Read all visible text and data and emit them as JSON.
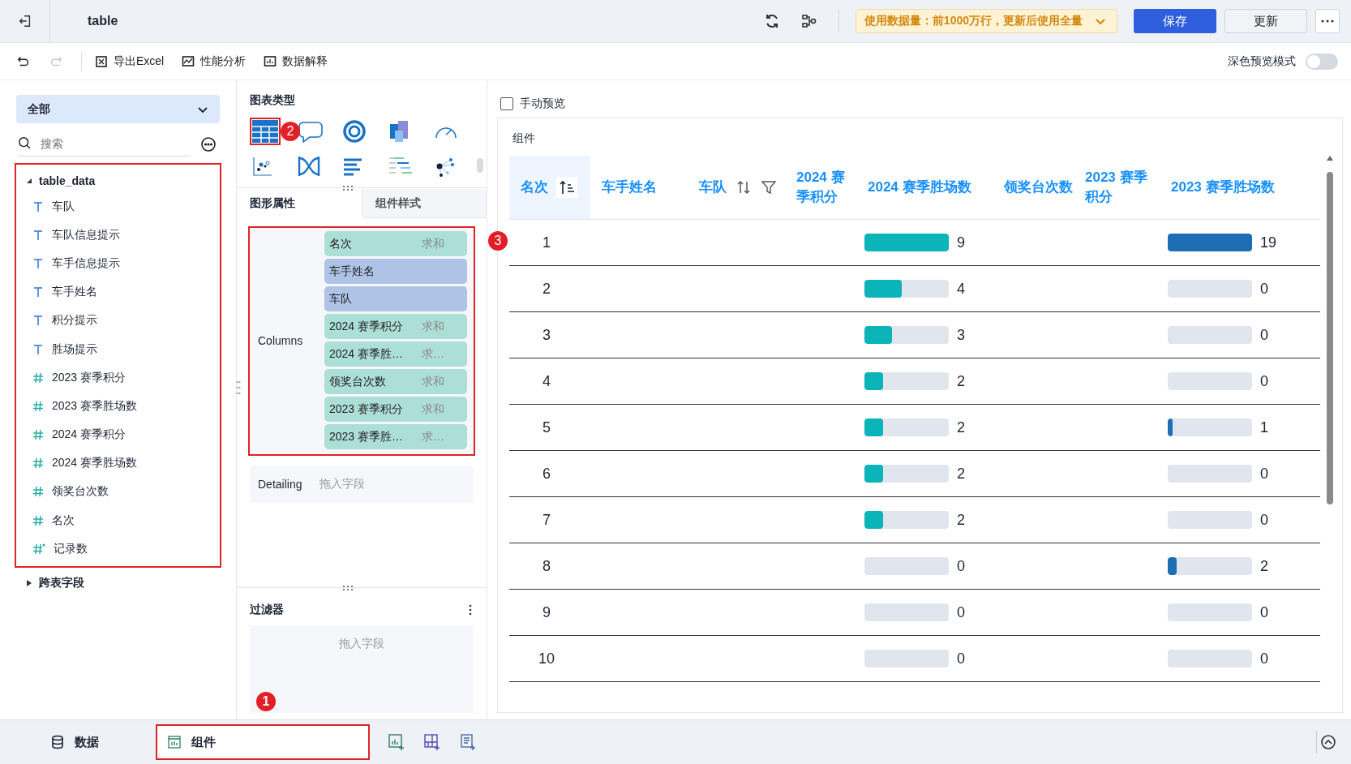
{
  "header": {
    "title": "table",
    "notice": "使用数据量：前1000万行，更新后使用全量",
    "save": "保存",
    "update": "更新"
  },
  "toolbar": {
    "items": [
      {
        "kind": "excel",
        "label": "导出Excel"
      },
      {
        "kind": "perf",
        "label": "性能分析"
      },
      {
        "kind": "explain",
        "label": "数据解释"
      }
    ],
    "dark_mode": {
      "label": "深色预览模式",
      "on": false
    }
  },
  "fields_panel": {
    "dropdown": "全部",
    "search_placeholder": "搜索",
    "highlighted": true,
    "tree": [
      {
        "label": "table_data",
        "expanded": true,
        "children": [
          {
            "label": "车队",
            "kind": "text"
          },
          {
            "label": "车队信息提示",
            "kind": "text"
          },
          {
            "label": "车手信息提示",
            "kind": "text"
          },
          {
            "label": "车手姓名",
            "kind": "text"
          },
          {
            "label": "积分提示",
            "kind": "text"
          },
          {
            "label": "胜场提示",
            "kind": "text"
          },
          {
            "label": "2023 赛季积分",
            "kind": "number"
          },
          {
            "label": "2023 赛季胜场数",
            "kind": "number"
          },
          {
            "label": "2024 赛季积分",
            "kind": "number"
          },
          {
            "label": "2024 赛季胜场数",
            "kind": "number"
          },
          {
            "label": "领奖台次数",
            "kind": "number"
          },
          {
            "label": "名次",
            "kind": "number"
          },
          {
            "label": "记录数",
            "kind": "count"
          }
        ]
      }
    ],
    "cross_table": {
      "label": "跨表字段",
      "expanded": false
    }
  },
  "config_panel": {
    "chart_types_title": "图表类型",
    "chart_types": [
      {
        "kind": "table",
        "selected": true,
        "badge": "2"
      },
      {
        "kind": "bubble",
        "selected": false
      },
      {
        "kind": "ring",
        "selected": false
      },
      {
        "kind": "cube",
        "selected": false
      },
      {
        "kind": "gauge",
        "selected": false
      },
      {
        "kind": "scatter",
        "selected": false
      },
      {
        "kind": "sankey",
        "selected": false
      },
      {
        "kind": "bars",
        "selected": false
      },
      {
        "kind": "gantt",
        "selected": false
      },
      {
        "kind": "network",
        "selected": false
      }
    ],
    "tabs": [
      {
        "label": "图形属性",
        "selected": true
      },
      {
        "label": "组件样式",
        "selected": false
      }
    ],
    "columns": {
      "label": "Columns",
      "highlighted": true,
      "badge": "3",
      "fields": [
        {
          "name": "名次",
          "agg": "求和",
          "kind": "measure"
        },
        {
          "name": "车手姓名",
          "kind": "dimension"
        },
        {
          "name": "车队",
          "kind": "dimension"
        },
        {
          "name": "2024 赛季积分",
          "agg": "求和",
          "kind": "measure"
        },
        {
          "name": "2024 赛季胜…",
          "agg": "求…",
          "kind": "measure"
        },
        {
          "name": "领奖台次数",
          "agg": "求和",
          "kind": "measure"
        },
        {
          "name": "2023 赛季积分",
          "agg": "求和",
          "kind": "measure"
        },
        {
          "name": "2023 赛季胜…",
          "agg": "求…",
          "kind": "measure"
        }
      ]
    },
    "detailing": {
      "label": "Detailing",
      "placeholder": "拖入字段"
    },
    "filter": {
      "title": "过滤器",
      "placeholder": "拖入字段"
    }
  },
  "preview": {
    "manual_preview": {
      "label": "手动预览",
      "checked": false
    },
    "panel_title": "组件",
    "table": {
      "columns": [
        {
          "label": "名次",
          "kind": "rank",
          "sort_icon": true,
          "sorted": true,
          "filter": false,
          "selected": true
        },
        {
          "label": "车手姓名",
          "kind": "empty",
          "sort_icon": false,
          "sorted": false,
          "filter": false,
          "selected": false
        },
        {
          "label": "车队",
          "kind": "empty",
          "sort_icon": true,
          "sorted": false,
          "filter": true,
          "selected": false
        },
        {
          "label": "2024 赛季积分",
          "kind": "empty",
          "sort_icon": false,
          "sorted": false,
          "filter": false,
          "selected": false
        },
        {
          "label": "2024 赛季胜场数",
          "kind": "bar",
          "color": "#0ab4b9",
          "sort_icon": false,
          "sorted": false,
          "filter": false,
          "selected": false
        },
        {
          "label": "领奖台次数",
          "kind": "empty",
          "sort_icon": false,
          "sorted": false,
          "filter": false,
          "selected": false
        },
        {
          "label": "2023 赛季积分",
          "kind": "empty",
          "sort_icon": false,
          "sorted": false,
          "filter": false,
          "selected": false
        },
        {
          "label": "2023 赛季胜场数",
          "kind": "bar",
          "color": "#1f6db2",
          "sort_icon": false,
          "sorted": false,
          "filter": false,
          "selected": false
        }
      ],
      "rows": [
        {
          "rank": "1",
          "wins_2024": {
            "value": "9",
            "level": 1
          },
          "wins_2023": {
            "value": "19",
            "level": 1
          }
        },
        {
          "rank": "2",
          "wins_2024": {
            "value": "4",
            "level": 0.44
          },
          "wins_2023": {
            "value": "0",
            "level": 0
          }
        },
        {
          "rank": "3",
          "wins_2024": {
            "value": "3",
            "level": 0.33
          },
          "wins_2023": {
            "value": "0",
            "level": 0
          }
        },
        {
          "rank": "4",
          "wins_2024": {
            "value": "2",
            "level": 0.22
          },
          "wins_2023": {
            "value": "0",
            "level": 0
          }
        },
        {
          "rank": "5",
          "wins_2024": {
            "value": "2",
            "level": 0.22
          },
          "wins_2023": {
            "value": "1",
            "level": 0.06
          }
        },
        {
          "rank": "6",
          "wins_2024": {
            "value": "2",
            "level": 0.22
          },
          "wins_2023": {
            "value": "0",
            "level": 0
          }
        },
        {
          "rank": "7",
          "wins_2024": {
            "value": "2",
            "level": 0.22
          },
          "wins_2023": {
            "value": "0",
            "level": 0
          }
        },
        {
          "rank": "8",
          "wins_2024": {
            "value": "0",
            "level": 0
          },
          "wins_2023": {
            "value": "2",
            "level": 0.11
          }
        },
        {
          "rank": "9",
          "wins_2024": {
            "value": "0",
            "level": 0
          },
          "wins_2023": {
            "value": "0",
            "level": 0
          }
        },
        {
          "rank": "10",
          "wins_2024": {
            "value": "0",
            "level": 0
          },
          "wins_2023": {
            "value": "0",
            "level": 0
          }
        }
      ]
    }
  },
  "bottom_bar": {
    "tabs": [
      {
        "kind": "data",
        "label": "数据",
        "selected": false
      },
      {
        "kind": "component",
        "label": "组件",
        "selected": true,
        "highlighted": true,
        "badge": "1"
      }
    ],
    "actions": [
      {
        "kind": "add-chart"
      },
      {
        "kind": "add-grid"
      },
      {
        "kind": "add-report"
      }
    ]
  }
}
